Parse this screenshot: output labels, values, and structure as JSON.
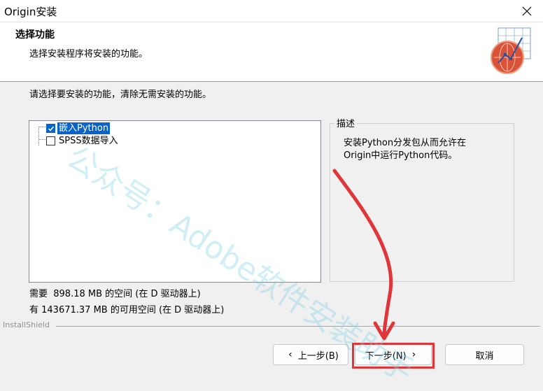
{
  "window": {
    "title": "Origin安装"
  },
  "header": {
    "title": "选择功能",
    "subtitle": "选择安装程序将安装的功能。"
  },
  "prompt": "请选择要安装的功能，清除无需安装的功能。",
  "features": [
    {
      "label": "嵌入Python",
      "checked": true,
      "selected": true
    },
    {
      "label": "SPSS数据导入",
      "checked": false,
      "selected": false
    }
  ],
  "description": {
    "legend": "描述",
    "text": "安装Python分发包从而允许在\nOrigin中运行Python代码。"
  },
  "space": {
    "required": "需要  898.18 MB 的空间 (在 D 驱动器上)",
    "available": "有 143671.37 MB 的可用空间 (在 D 驱动器上)"
  },
  "footer": {
    "brand": "InstallShield"
  },
  "buttons": {
    "back": "上一步(B)",
    "next": "下一步(N)",
    "cancel": "取消"
  },
  "watermark": "公众号：Adobe软件安装助手",
  "colors": {
    "selection": "#0a64c8",
    "annotation": "#e0363a"
  }
}
